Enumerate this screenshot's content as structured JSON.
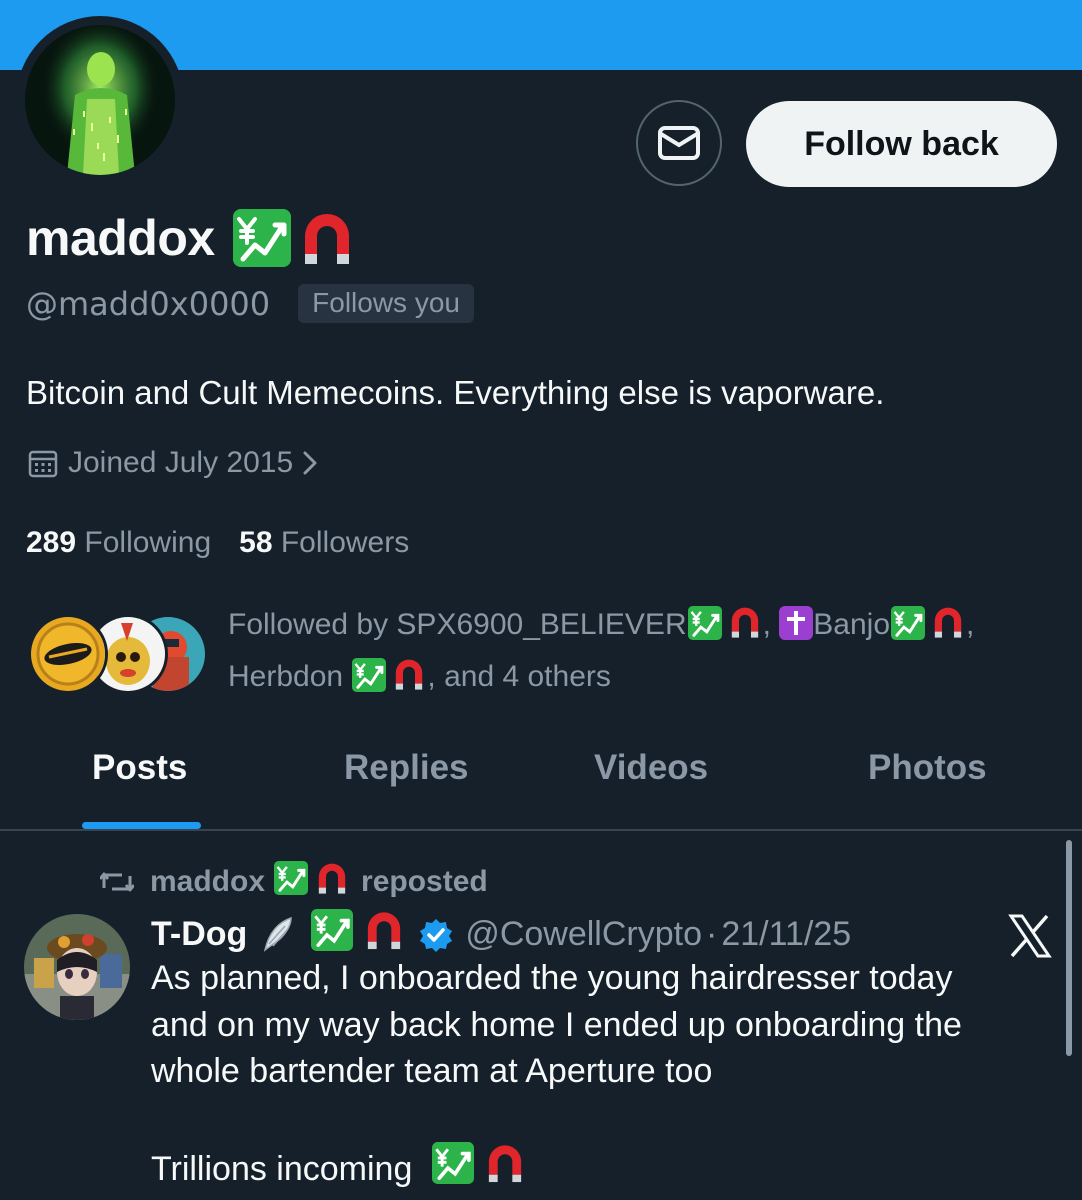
{
  "profile": {
    "display_name": "maddox",
    "handle": "@madd0x0000",
    "follows_you_badge": "Follows you",
    "bio": "Bitcoin and Cult Memecoins. Everything else is vaporware.",
    "joined": "Joined July 2015"
  },
  "actions": {
    "follow_back_label": "Follow back",
    "message_icon": "mail-icon"
  },
  "stats": {
    "following_count": "289",
    "following_label": "Following",
    "followers_count": "58",
    "followers_label": "Followers"
  },
  "followed_by": {
    "prefix": "Followed by",
    "user1": "SPX6900_BELIEVER",
    "user2": "Banjo",
    "user3": "Herbdon",
    "suffix": ", and 4 others"
  },
  "tabs": [
    {
      "label": "Posts",
      "active": true
    },
    {
      "label": "Replies",
      "active": false
    },
    {
      "label": "Videos",
      "active": false
    },
    {
      "label": "Photos",
      "active": false
    }
  ],
  "post": {
    "repost_author": "maddox",
    "repost_label": "reposted",
    "author": "T-Dog",
    "handle": "@CowellCrypto",
    "separator": "·",
    "date": "21/11/25",
    "body_line1": "As planned, I onboarded the young hairdresser today",
    "body_line2": "and on my way back home I ended up onboarding the",
    "body_line3": "whole bartender team at Aperture too",
    "body_line4": "Trillions incoming"
  },
  "colors": {
    "background": "#15202b",
    "banner": "#1d9bf0",
    "accent": "#1d9bf0",
    "secondary_text": "#8b98a5",
    "primary_text": "#f7f9f9",
    "follow_button_bg": "#eff3f4",
    "verified": "#1d9bf0"
  }
}
